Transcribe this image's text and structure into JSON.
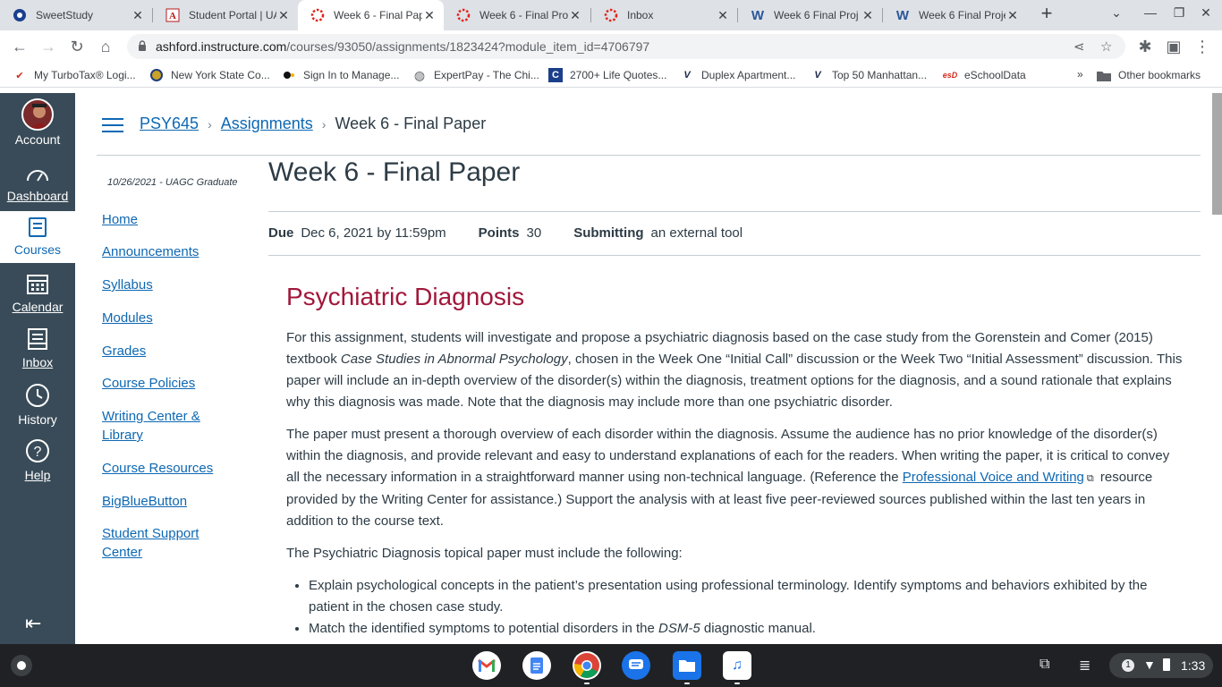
{
  "browser": {
    "tabs": [
      {
        "title": "SweetStudy",
        "icon": "sweetstudy-icon"
      },
      {
        "title": "Student Portal | UA",
        "icon": "university-icon"
      },
      {
        "title": "Week 6 - Final Pap",
        "icon": "canvas-icon",
        "active": true
      },
      {
        "title": "Week 6 - Final Pro",
        "icon": "canvas-icon"
      },
      {
        "title": "Inbox",
        "icon": "canvas-icon"
      },
      {
        "title": "Week 6 Final Proj",
        "icon": "word-icon"
      },
      {
        "title": "Week 6 Final Proje",
        "icon": "word-icon"
      }
    ],
    "url_host": "ashford.instructure.com",
    "url_path": "/courses/93050/assignments/1823424?module_item_id=4706797",
    "bookmarks": [
      "My TurboTax® Logi...",
      "New York State Co...",
      "Sign In to Manage...",
      "ExpertPay - The Chi...",
      "2700+ Life Quotes...",
      "Duplex Apartment...",
      "Top 50 Manhattan...",
      "eSchoolData"
    ],
    "more_bookmarks": "»",
    "other_bookmarks": "Other bookmarks"
  },
  "global_nav": {
    "account": "Account",
    "dashboard": "Dashboard",
    "courses": "Courses",
    "calendar": "Calendar",
    "inbox": "Inbox",
    "history": "History",
    "help": "Help"
  },
  "breadcrumb": {
    "course": "PSY645",
    "section": "Assignments",
    "current": "Week 6 - Final Paper"
  },
  "course_nav": {
    "term": "10/26/2021 - UAGC Graduate",
    "items": [
      "Home",
      "Announcements",
      "Syllabus",
      "Modules",
      "Grades",
      "Course Policies",
      "Writing Center & Library",
      "Course Resources",
      "BigBlueButton",
      "Student Support Center"
    ]
  },
  "assignment": {
    "title": "Week 6 - Final Paper",
    "due_label": "Due",
    "due_value": "Dec 6, 2021 by 11:59pm",
    "points_label": "Points",
    "points_value": "30",
    "submitting_label": "Submitting",
    "submitting_value": "an external tool",
    "heading": "Psychiatric Diagnosis",
    "p1_a": "For this assignment, students will investigate and propose a psychiatric diagnosis based on the case study from the Gorenstein and Comer (2015) textbook ",
    "p1_italic": "Case Studies in Abnormal Psychology",
    "p1_b": ", chosen in the Week One “Initial Call” discussion or the Week Two “Initial Assessment” discussion. This paper will include an in-depth overview of the disorder(s) within the diagnosis, treatment options for the diagnosis, and a sound rationale that explains why this diagnosis was made. Note that the diagnosis may include more than one psychiatric disorder.",
    "p2_a": "The paper must present a thorough overview of each disorder within the diagnosis. Assume the audience has no prior knowledge of the disorder(s) within the diagnosis, and provide relevant and easy to understand explanations of each for the readers. When writing the paper, it is critical to convey all the necessary information in a straightforward manner using non-technical language. (Reference the ",
    "p2_link": "Professional Voice and Writing",
    "p2_b": " resource provided by the Writing Center for assistance.) Support the analysis with at least five peer-reviewed sources published within the last ten years in addition to the course text.",
    "p3": "The Psychiatric Diagnosis topical paper must include the following:",
    "bullet1": "Explain psychological concepts in the patient’s presentation using professional terminology. Identify symptoms and behaviors exhibited by the patient in the chosen case study.",
    "bullet2_a": "Match the identified symptoms to potential disorders in the ",
    "bullet2_italic": "DSM-5",
    "bullet2_b": " diagnostic manual."
  },
  "shelf": {
    "apps": [
      "Gmail",
      "Docs",
      "Chrome",
      "Messages",
      "Files",
      "Music"
    ],
    "notifications": "1",
    "time": "1:33"
  },
  "colors": {
    "canvas_nav": "#394b58",
    "link": "#0e68b3",
    "heading_accent": "#a1173a"
  }
}
